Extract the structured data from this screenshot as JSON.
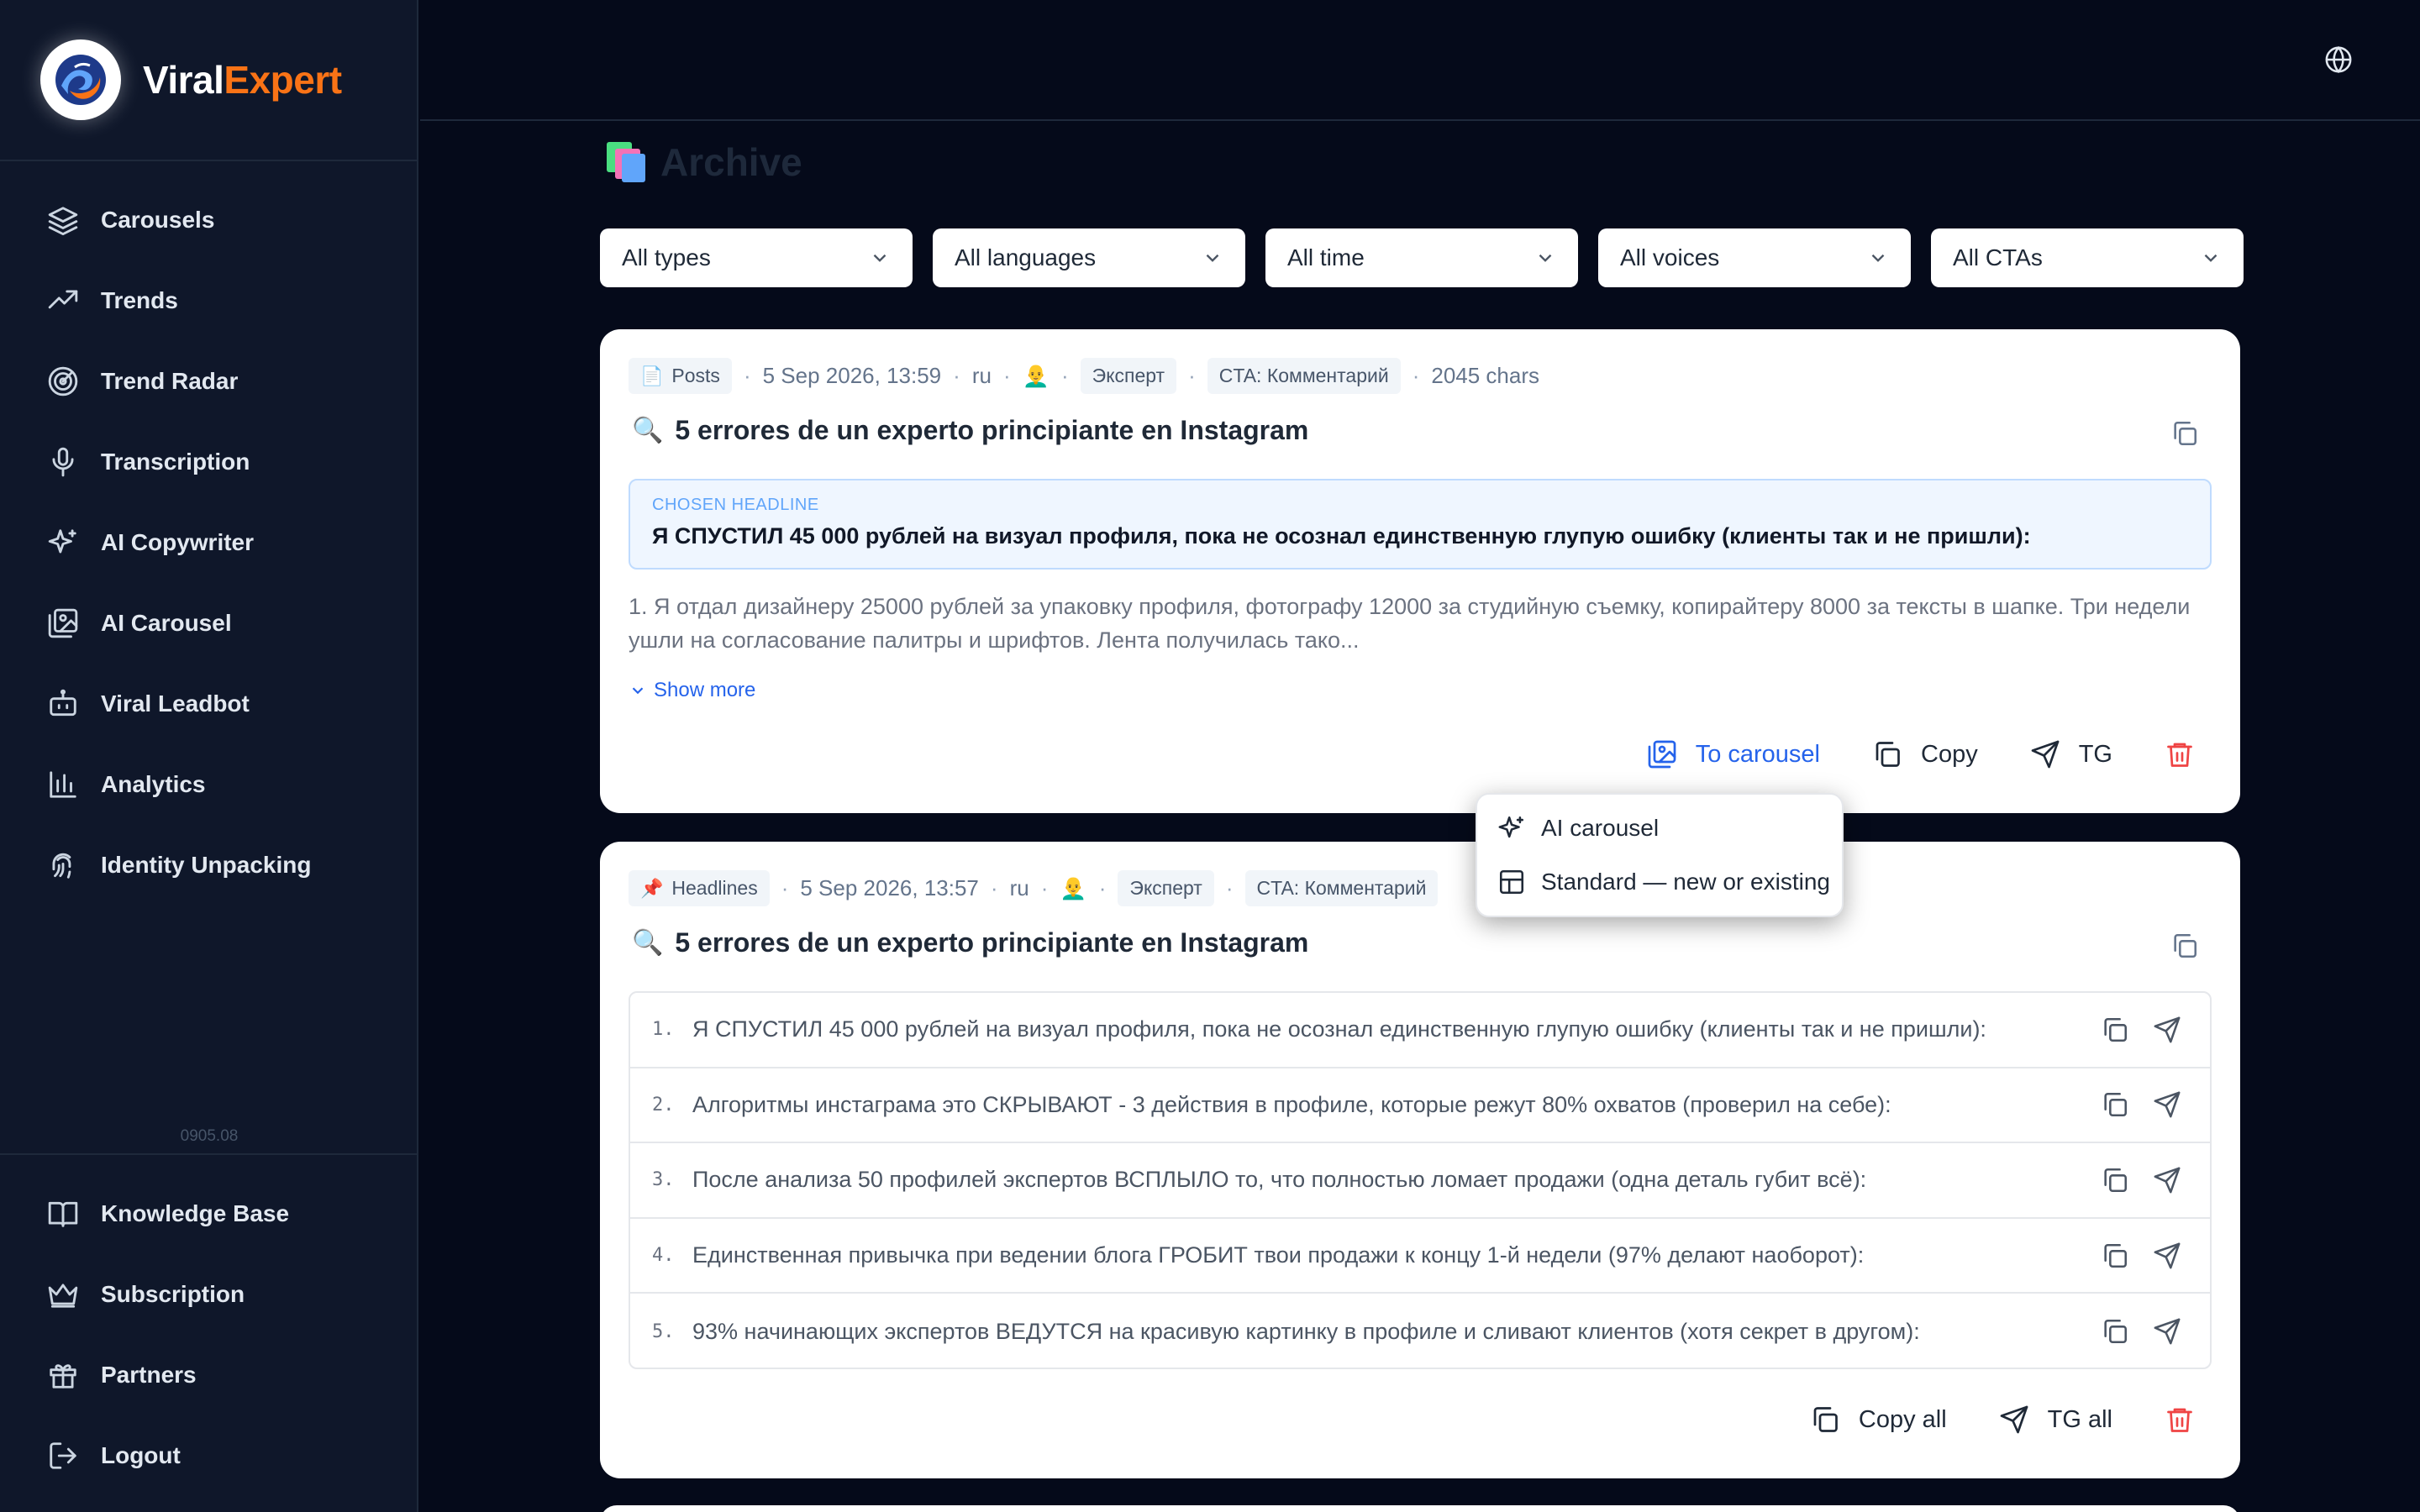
{
  "brand": {
    "name_part1": "Viral",
    "name_part2": "Expert"
  },
  "sidebar": {
    "items": [
      {
        "label": "Carousels",
        "icon": "layers-icon"
      },
      {
        "label": "Trends",
        "icon": "trending-up-icon"
      },
      {
        "label": "Trend Radar",
        "icon": "radar-icon"
      },
      {
        "label": "Transcription",
        "icon": "microphone-icon"
      },
      {
        "label": "AI Copywriter",
        "icon": "sparkles-icon"
      },
      {
        "label": "AI Carousel",
        "icon": "image-gallery-icon"
      },
      {
        "label": "Viral Leadbot",
        "icon": "bot-icon"
      },
      {
        "label": "Analytics",
        "icon": "bar-chart-icon"
      },
      {
        "label": "Identity Unpacking",
        "icon": "fingerprint-icon"
      }
    ],
    "version": "0905.08",
    "bottom_items": [
      {
        "label": "Knowledge Base",
        "icon": "book-icon"
      },
      {
        "label": "Subscription",
        "icon": "crown-icon"
      },
      {
        "label": "Partners",
        "icon": "gift-icon"
      },
      {
        "label": "Logout",
        "icon": "logout-icon"
      }
    ]
  },
  "page": {
    "title": "Archive"
  },
  "filters": [
    "All types",
    "All languages",
    "All time",
    "All voices",
    "All CTAs"
  ],
  "cards": [
    {
      "type_label": "Posts",
      "type_icon": "📄",
      "date": "5 Sep 2026, 13:59",
      "lang": "ru",
      "avatar": "👨‍🦲",
      "voice": "Эксперт",
      "cta": "CTA: Комментарий",
      "chars": "2045 chars",
      "title_icon": "🔍",
      "title": "5 errores de un experto principiante en Instagram",
      "chosen_label": "CHOSEN HEADLINE",
      "chosen_text": "Я СПУСТИЛ 45 000 рублей на визуал профиля, пока не осознал единственную глупую ошибку (клиенты так и не пришли):",
      "body": "1. Я отдал дизайнеру 25000 рублей за упаковку профиля, фотографу 12000 за студийную съемку, копирайтеру 8000 за тексты в шапке. Три недели ушли на согласование палитры и шрифтов. Лента получилась тако...",
      "show_more": "Show more",
      "actions": {
        "carousel": "To carousel",
        "copy": "Copy",
        "tg": "TG"
      }
    },
    {
      "type_label": "Headlines",
      "type_icon": "📌",
      "date": "5 Sep 2026, 13:57",
      "lang": "ru",
      "avatar": "👨‍🦲",
      "voice": "Эксперт",
      "cta": "CTA: Комментарий",
      "title_icon": "🔍",
      "title": "5 errores de un experto principiante en Instagram",
      "headlines": [
        {
          "num": "1.",
          "text": "Я СПУСТИЛ 45 000 рублей на визуал профиля, пока не осознал единственную глупую ошибку (клиенты так и не пришли):"
        },
        {
          "num": "2.",
          "text": "Алгоритмы инстаграма это СКРЫВАЮТ - 3 действия в профиле, которые режут 80% охватов (проверил на себе):"
        },
        {
          "num": "3.",
          "text": "После анализа 50 профилей экспертов ВСПЛЫЛО то, что полностью ломает продажи (одна деталь губит всё):"
        },
        {
          "num": "4.",
          "text": "Единственная привычка при ведении блога ГРОБИТ твои продажи к концу 1-й недели (97% делают наоборот):"
        },
        {
          "num": "5.",
          "text": "93% начинающих экспертов ВЕДУТСЯ на красивую картинку в профиле и сливают клиентов (хотя секрет в другом):"
        }
      ],
      "actions": {
        "copy_all": "Copy all",
        "tg_all": "TG all"
      }
    }
  ],
  "dropdown": {
    "items": [
      {
        "label": "AI carousel",
        "icon": "sparkles-icon"
      },
      {
        "label": "Standard — new or existing",
        "icon": "layout-icon"
      }
    ]
  },
  "colors": {
    "accent": "#2563eb",
    "brand_orange": "#f97316",
    "danger": "#ef4444",
    "bg": "#050a1a",
    "sidebar": "#0f172a"
  }
}
